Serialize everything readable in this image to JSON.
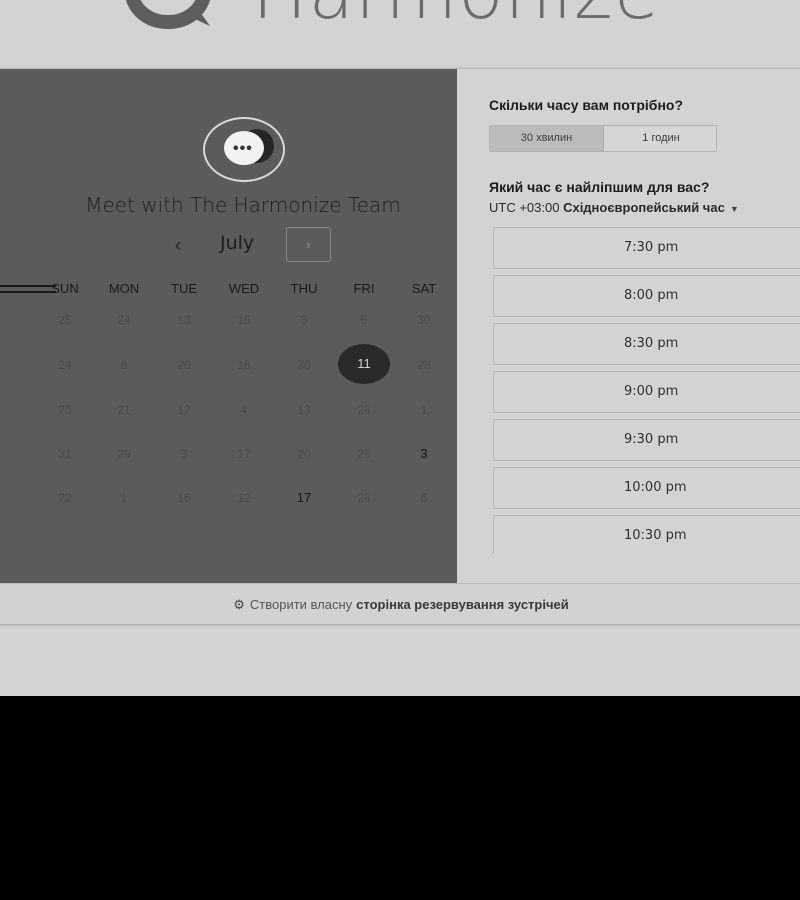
{
  "header": {
    "brand": "Harmonize"
  },
  "calendar": {
    "title": "Meet with The Harmonize Team",
    "month": "July",
    "prev_label": "‹",
    "next_label": "›",
    "weekdays": [
      "SUN",
      "MON",
      "TUE",
      "WED",
      "THU",
      "FRI",
      "SAT"
    ],
    "weeks": [
      [
        "25",
        "24",
        "13",
        "15",
        "3",
        "5",
        "30"
      ],
      [
        "24",
        "8",
        "26",
        "18",
        "30",
        "11",
        "28"
      ],
      [
        "20",
        "21",
        "12",
        "4",
        "13",
        "26",
        "1"
      ],
      [
        "31",
        "29",
        "3",
        "17",
        "20",
        "25",
        "3"
      ],
      [
        "22",
        "1",
        "16",
        "12",
        "17",
        "26",
        "6"
      ]
    ],
    "selected": "11",
    "available": [
      "3",
      "17"
    ]
  },
  "booking": {
    "duration_question": "Скільки часу вам потрібно?",
    "durations": [
      "30 хвилин",
      "1 годин"
    ],
    "active_duration": "30 хвилин",
    "time_question": "Який час є найліпшим для вас?",
    "timezone_offset": "UTC +03:00",
    "timezone_name": "Східноєвропейський час",
    "slots": [
      "7:30 pm",
      "8:00 pm",
      "8:30 pm",
      "9:00 pm",
      "9:30 pm",
      "10:00 pm",
      "10:30 pm"
    ]
  },
  "footer": {
    "icon": "hubspot-sprocket-icon",
    "text_prefix": "Створити власну",
    "text_bold": "сторінка резервування зустрічей"
  }
}
